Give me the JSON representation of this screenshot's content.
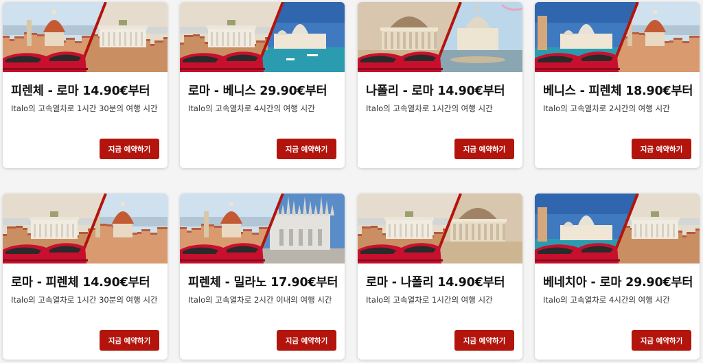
{
  "colors": {
    "button": "#b3140c",
    "train_red": "#c8102e",
    "divider_red": "#b3140c"
  },
  "cards": [
    {
      "title": "피렌체 - 로마 14.90€부터",
      "description": "Italo의 고속열차로 1시간 30분의 여행 시간",
      "button": "지금 예약하기",
      "left_scene": "florence",
      "right_scene": "rome"
    },
    {
      "title": "로마 - 베니스 29.90€부터",
      "description": "Italo의 고속열차로 4시간의 여행 시간",
      "button": "지금 예약하기",
      "left_scene": "rome",
      "right_scene": "venice"
    },
    {
      "title": "나폴리 - 로마 14.90€부터",
      "description": "Italo의 고속열차로 1시간의 여행 시간",
      "button": "지금 예약하기",
      "left_scene": "naples",
      "right_scene": "vatican"
    },
    {
      "title": "베니스 - 피렌체 18.90€부터",
      "description": "Italo의 고속열차로 2시간의 여행 시간",
      "button": "지금 예약하기",
      "left_scene": "venice",
      "right_scene": "florence"
    },
    {
      "title": "로마 - 피렌체 14.90€부터",
      "description": "Italo의 고속열차로 1시간 30분의 여행 시간",
      "button": "지금 예약하기",
      "left_scene": "rome",
      "right_scene": "florence"
    },
    {
      "title": "피렌체 - 밀라노 17.90€부터",
      "description": "Italo의 고속열차로 2시간 이내의 여행 시간",
      "button": "지금 예약하기",
      "left_scene": "florence",
      "right_scene": "milan"
    },
    {
      "title": "로마 - 나폴리 14.90€부터",
      "description": "Italo의 고속열차로 1시간의 여행 시간",
      "button": "지금 예약하기",
      "left_scene": "rome",
      "right_scene": "naples"
    },
    {
      "title": "베네치아 - 로마 29.90€부터",
      "description": "Italo의 고속열차로 4시간의 여행 시간",
      "button": "지금 예약하기",
      "left_scene": "venice",
      "right_scene": "rome"
    }
  ]
}
